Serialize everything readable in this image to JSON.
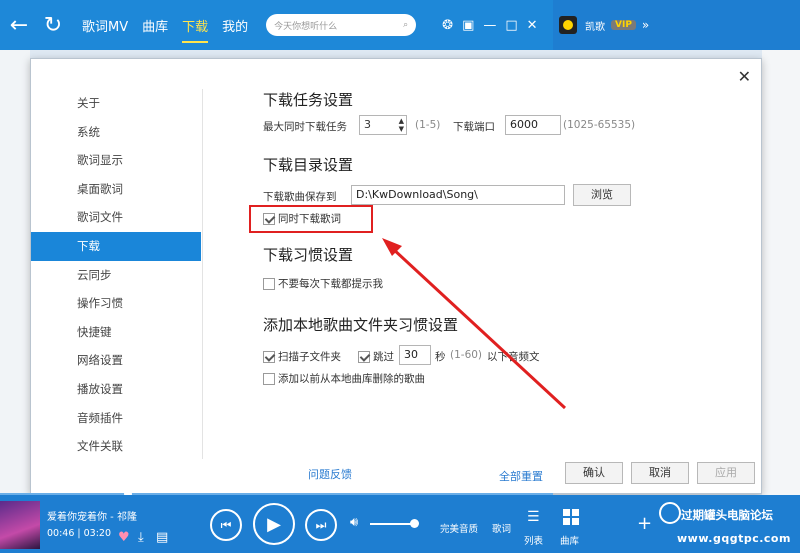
{
  "topbar": {
    "nav": [
      "歌词MV",
      "曲库",
      "下载",
      "我的"
    ],
    "active_nav": "下载",
    "search_placeholder": "今天你想听什么"
  },
  "rightbar": {
    "username": "凯歌",
    "vip": "VIP",
    "more": "»"
  },
  "dialog": {
    "sidebar": [
      "关于",
      "系统",
      "歌词显示",
      "桌面歌词",
      "歌词文件",
      "下载",
      "云同步",
      "操作习惯",
      "快捷键",
      "网络设置",
      "播放设置",
      "音频插件",
      "文件关联"
    ],
    "active_item": "下载",
    "task": {
      "heading": "下载任务设置",
      "max_label": "最大同时下载任务",
      "max_value": "3",
      "max_range": "(1-5)",
      "port_label": "下载端口",
      "port_value": "6000",
      "port_range": "(1025-65535)"
    },
    "dir": {
      "heading": "下载目录设置",
      "save_label": "下载歌曲保存到",
      "path": "D:\\KwDownload\\Song\\",
      "browse": "浏览",
      "lyrics_checkbox": "同时下载歌词",
      "lyrics_checked": true
    },
    "habit": {
      "heading": "下载习惯设置",
      "no_prompt": "不要每次下载都提示我",
      "no_prompt_checked": false
    },
    "local": {
      "heading": "添加本地歌曲文件夹习惯设置",
      "scan_sub": "扫描子文件夹",
      "scan_sub_checked": true,
      "skip": "跳过",
      "skip_checked": true,
      "skip_value": "30",
      "skip_unit": "秒",
      "skip_range": "(1-60)",
      "skip_tail": "以下音频文",
      "add_deleted": "添加以前从本地曲库删除的歌曲",
      "add_deleted_checked": false
    },
    "footer": {
      "feedback": "问题反馈",
      "reset_all": "全部重置",
      "ok": "确认",
      "cancel": "取消",
      "apply": "应用"
    }
  },
  "player": {
    "song": "爱着你宠着你 - 祁隆",
    "time": "00:46 | 03:20",
    "quality": "完美音质",
    "lyrics": "歌词",
    "playlist": "列表",
    "library": "曲库"
  },
  "watermark": {
    "line1": "过期罐头电脑论坛",
    "line2": "www.gqgtpc.com"
  },
  "colors": {
    "accent": "#1e88d8",
    "highlight": "#e02020"
  }
}
